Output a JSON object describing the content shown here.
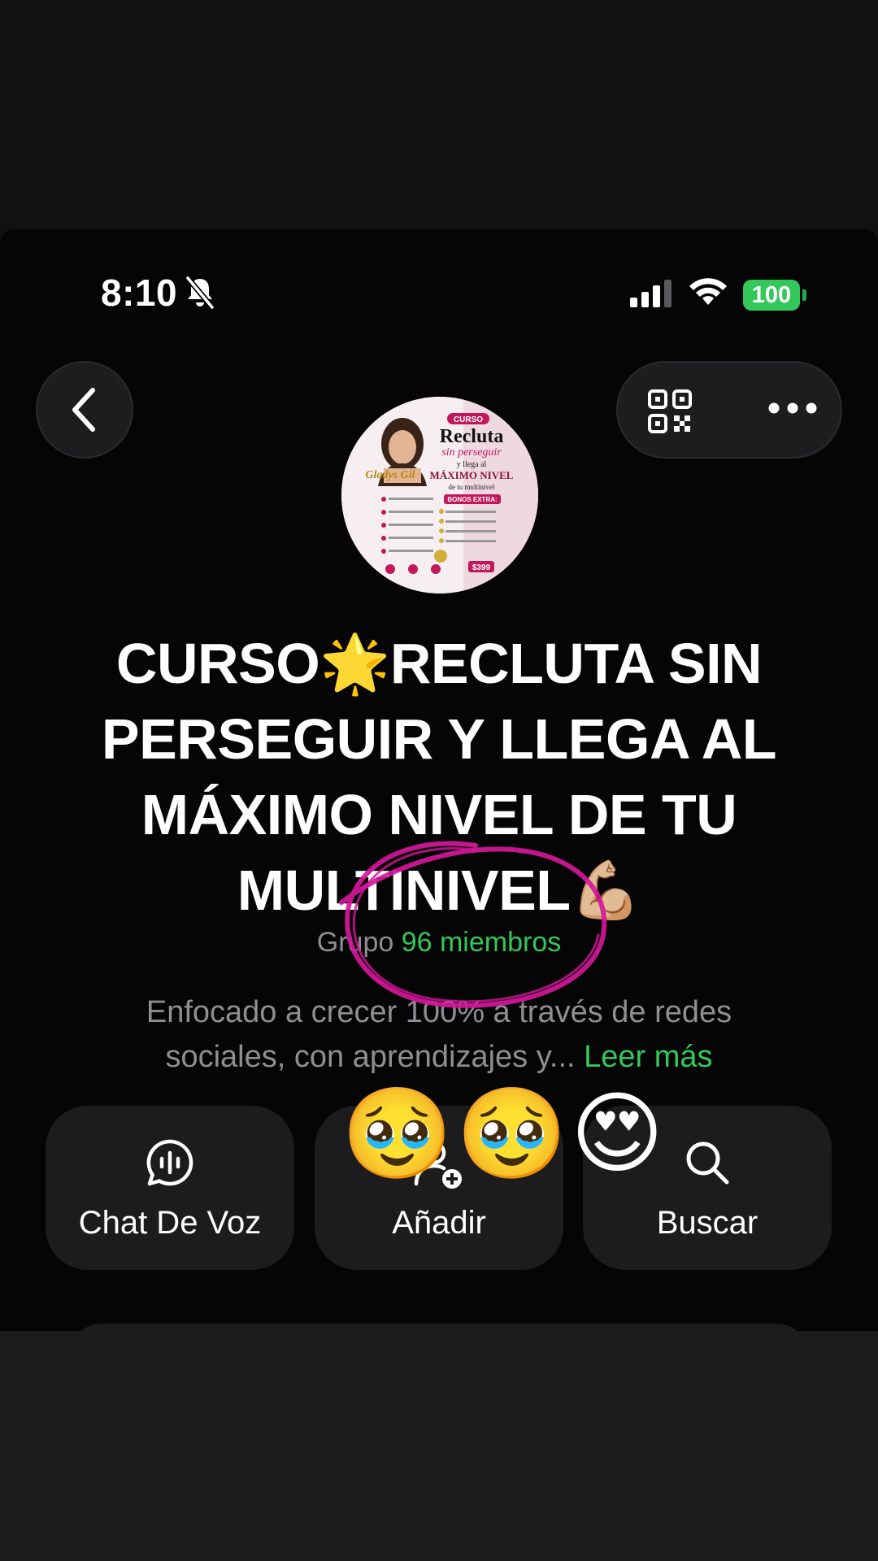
{
  "status_bar": {
    "time": "8:10",
    "battery": "100"
  },
  "header": {
    "back_icon": "chevron-left-icon",
    "qr_icon": "qr-code-icon",
    "more_icon": "ellipsis-icon"
  },
  "group": {
    "title_line1": "CURSO🌟RECLUTA SIN",
    "title_line2": "PERSEGUIR Y LLEGA AL",
    "title_line3": "MÁXIMO NIVEL DE TU",
    "title_line4": "MULTINIVEL💪🏼",
    "type_label": "Grupo",
    "members_label": "96 miembros",
    "description_line1": "Enfocado a crecer 100% a través de redes",
    "description_line2": "sociales, con aprendizajes y...",
    "read_more": "Leer más"
  },
  "avatar_poster": {
    "tag": "CURSO",
    "line1": "Recluta",
    "line2": "sin perseguir",
    "line3": "y llega al",
    "line4": "MÁXIMO NIVEL",
    "line5": "de tu multinivel",
    "name": "Gladys Gil",
    "bonus": "BONOS EXTRA:",
    "price": "$399"
  },
  "actions": [
    {
      "label": "Chat De Voz",
      "icon": "voice-chat-icon"
    },
    {
      "label": "Añadir",
      "icon": "add-person-icon"
    },
    {
      "label": "Buscar",
      "icon": "search-icon"
    }
  ],
  "overlay": {
    "emojis": "🥹🥹😍",
    "annotation": "circle-scribble"
  },
  "colors": {
    "accent": "#34c759",
    "scribble": "#d4179a",
    "background": "#050505"
  }
}
